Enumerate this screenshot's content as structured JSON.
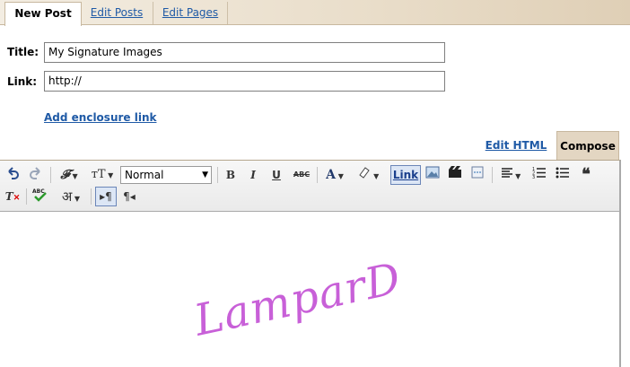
{
  "tabs": [
    {
      "label": "New Post",
      "active": true
    },
    {
      "label": "Edit Posts",
      "active": false
    },
    {
      "label": "Edit Pages",
      "active": false
    }
  ],
  "form": {
    "title_label": "Title:",
    "title_value": "My Signature Images",
    "link_label": "Link:",
    "link_value": "http://",
    "enclosure_link": "Add enclosure link"
  },
  "mode_tabs": {
    "edit_html": "Edit HTML",
    "compose": "Compose"
  },
  "toolbar": {
    "font_select": "Normal",
    "bold": "B",
    "italic": "I",
    "underline": "U",
    "strike": "ABC",
    "link": "Link",
    "hindi": "अ"
  },
  "content": {
    "signature_text": "LamparD",
    "signature_color": "#c860d8"
  }
}
